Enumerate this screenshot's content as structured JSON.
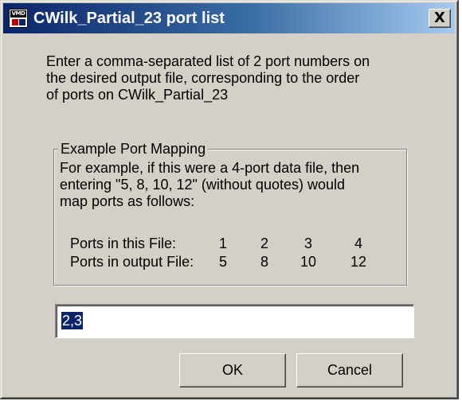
{
  "window": {
    "title": "CWilk_Partial_23 port list",
    "icon": "app-icon",
    "close_label": "X"
  },
  "prompt": {
    "line1": "Enter a comma-separated list of 2 port numbers on",
    "line2": "the desired output file, corresponding to the order",
    "line3": "of ports on CWilk_Partial_23"
  },
  "group": {
    "legend": "Example Port Mapping",
    "line1": "For example, if this were a 4-port data file, then",
    "line2": "entering \"5, 8, 10, 12\" (without quotes) would",
    "line3": "map ports as follows:",
    "mapping": {
      "row1_label": "Ports in this File:",
      "row1_values": [
        "1",
        "2",
        "3",
        "4"
      ],
      "row2_label": "Ports in output File:",
      "row2_values": [
        "5",
        "8",
        "10",
        "12"
      ]
    }
  },
  "input": {
    "value": "2,3"
  },
  "buttons": {
    "ok_label": "OK",
    "cancel_label": "Cancel"
  },
  "colors": {
    "titlebar_start": "#0a246a",
    "titlebar_end": "#a6caf0",
    "dialog_bg": "#d4d0c8",
    "selection": "#0a246a"
  }
}
